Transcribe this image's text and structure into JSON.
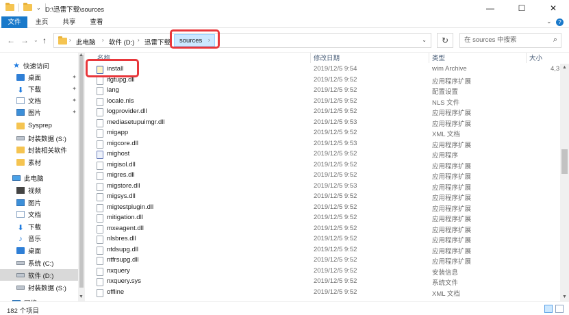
{
  "window": {
    "title": "D:\\迅雷下载\\sources",
    "minimize_icon": "—",
    "maximize_icon": "☐",
    "close_icon": "✕"
  },
  "ribbon": {
    "tabs": [
      "文件",
      "主页",
      "共享",
      "查看"
    ],
    "expand_icon": "⌄",
    "help_icon": "?"
  },
  "nav": {
    "back": "←",
    "forward": "→",
    "recent": "⌄",
    "up": "↑",
    "breadcrumb": [
      "此电脑",
      "软件 (D:)",
      "迅雷下载",
      "sources"
    ],
    "arrow": "›",
    "refresh": "↻",
    "search_placeholder": "在 sources 中搜索",
    "search_icon": "⌕"
  },
  "sidebar": {
    "items": [
      {
        "label": "快速访问",
        "icon": "star-icon"
      },
      {
        "label": "桌面",
        "icon": "desktop-icon",
        "pinned": true
      },
      {
        "label": "下载",
        "icon": "download-icon",
        "pinned": true
      },
      {
        "label": "文档",
        "icon": "documents-icon",
        "pinned": true
      },
      {
        "label": "图片",
        "icon": "pictures-icon",
        "pinned": true
      },
      {
        "label": "Sysprep",
        "icon": "folder-icon"
      },
      {
        "label": "封装数据 (S:)",
        "icon": "drive-icon"
      },
      {
        "label": "封装相关软件",
        "icon": "folder-icon"
      },
      {
        "label": "素材",
        "icon": "folder-icon"
      },
      {
        "label": "此电脑",
        "icon": "computer-icon"
      },
      {
        "label": "视频",
        "icon": "videos-icon"
      },
      {
        "label": "图片",
        "icon": "pictures-icon"
      },
      {
        "label": "文档",
        "icon": "documents-icon"
      },
      {
        "label": "下载",
        "icon": "download-icon"
      },
      {
        "label": "音乐",
        "icon": "music-icon"
      },
      {
        "label": "桌面",
        "icon": "desktop-icon"
      },
      {
        "label": "系统 (C:)",
        "icon": "drive-icon"
      },
      {
        "label": "软件 (D:)",
        "icon": "drive-icon",
        "selected": true
      },
      {
        "label": "封装数据 (S:)",
        "icon": "drive-icon"
      },
      {
        "label": "网络",
        "icon": "network-icon"
      }
    ],
    "pin_icon": "📌"
  },
  "columns": {
    "name": "名称",
    "date": "修改日期",
    "type": "类型",
    "size": "大小"
  },
  "files": [
    {
      "name": "install",
      "date": "2019/12/5 9:54",
      "type": "wim Archive",
      "size": "4,3",
      "icon": "install"
    },
    {
      "name": "itgtupg.dll",
      "date": "2019/12/5 9:52",
      "type": "应用程序扩展",
      "size": "",
      "icon": "dll"
    },
    {
      "name": "lang",
      "date": "2019/12/5 9:52",
      "type": "配置设置",
      "size": "",
      "icon": "ini"
    },
    {
      "name": "locale.nls",
      "date": "2019/12/5 9:52",
      "type": "NLS 文件",
      "size": "",
      "icon": "file"
    },
    {
      "name": "logprovider.dll",
      "date": "2019/12/5 9:52",
      "type": "应用程序扩展",
      "size": "",
      "icon": "dll"
    },
    {
      "name": "mediasetupuimgr.dll",
      "date": "2019/12/5 9:53",
      "type": "应用程序扩展",
      "size": "",
      "icon": "dll"
    },
    {
      "name": "migapp",
      "date": "2019/12/5 9:52",
      "type": "XML 文档",
      "size": "",
      "icon": "xml"
    },
    {
      "name": "migcore.dll",
      "date": "2019/12/5 9:53",
      "type": "应用程序扩展",
      "size": "",
      "icon": "dll"
    },
    {
      "name": "mighost",
      "date": "2019/12/5 9:52",
      "type": "应用程序",
      "size": "",
      "icon": "exe"
    },
    {
      "name": "migisol.dll",
      "date": "2019/12/5 9:52",
      "type": "应用程序扩展",
      "size": "",
      "icon": "dll"
    },
    {
      "name": "migres.dll",
      "date": "2019/12/5 9:52",
      "type": "应用程序扩展",
      "size": "",
      "icon": "dll"
    },
    {
      "name": "migstore.dll",
      "date": "2019/12/5 9:53",
      "type": "应用程序扩展",
      "size": "",
      "icon": "dll"
    },
    {
      "name": "migsys.dll",
      "date": "2019/12/5 9:52",
      "type": "应用程序扩展",
      "size": "",
      "icon": "dll"
    },
    {
      "name": "migtestplugin.dll",
      "date": "2019/12/5 9:52",
      "type": "应用程序扩展",
      "size": "",
      "icon": "dll"
    },
    {
      "name": "mitigation.dll",
      "date": "2019/12/5 9:52",
      "type": "应用程序扩展",
      "size": "",
      "icon": "dll"
    },
    {
      "name": "mxeagent.dll",
      "date": "2019/12/5 9:52",
      "type": "应用程序扩展",
      "size": "",
      "icon": "dll"
    },
    {
      "name": "nlsbres.dll",
      "date": "2019/12/5 9:52",
      "type": "应用程序扩展",
      "size": "",
      "icon": "dll"
    },
    {
      "name": "ntdsupg.dll",
      "date": "2019/12/5 9:52",
      "type": "应用程序扩展",
      "size": "",
      "icon": "dll"
    },
    {
      "name": "ntfrsupg.dll",
      "date": "2019/12/5 9:52",
      "type": "应用程序扩展",
      "size": "",
      "icon": "dll"
    },
    {
      "name": "nxquery",
      "date": "2019/12/5 9:52",
      "type": "安装信息",
      "size": "",
      "icon": "inf"
    },
    {
      "name": "nxquery.sys",
      "date": "2019/12/5 9:52",
      "type": "系统文件",
      "size": "",
      "icon": "sys"
    },
    {
      "name": "offline",
      "date": "2019/12/5 9:52",
      "type": "XML 文档",
      "size": "",
      "icon": "xml"
    }
  ],
  "status": {
    "item_count": "182 个项目"
  },
  "colors": {
    "accent": "#1979ca",
    "highlight_box": "#e8373b",
    "selected_crumb": "#cce8ff"
  }
}
